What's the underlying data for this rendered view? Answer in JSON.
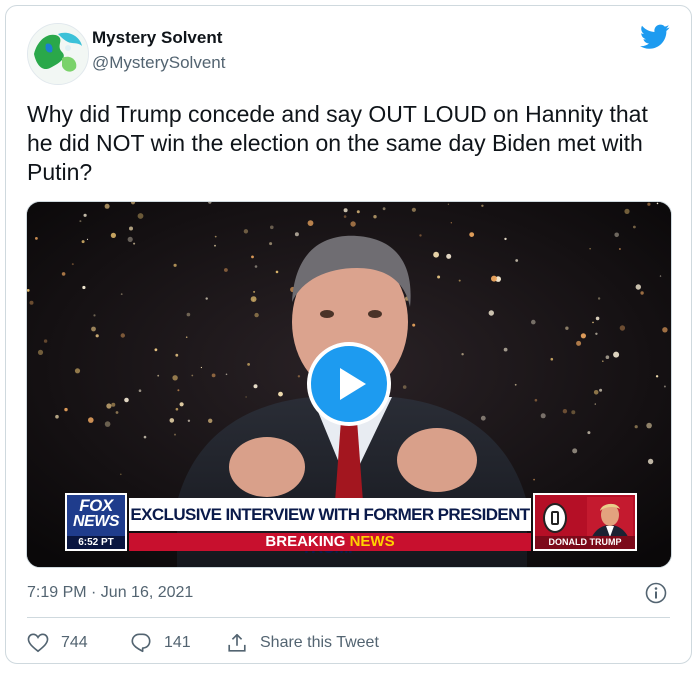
{
  "author": {
    "name": "Mystery Solvent",
    "handle": "@MysterySolvent"
  },
  "tweet": {
    "text": "Why did Trump concede and say OUT LOUD on Hannity that he did NOT win the election on the same day Biden met with Putin?",
    "timestamp": "7:19 PM · Jun 16, 2021"
  },
  "media": {
    "type": "video",
    "chyron": {
      "network_line1": "FOX",
      "network_line2": "NEWS",
      "clock": "6:52 PT",
      "headline": "EXCLUSIVE INTERVIEW WITH FORMER PRESIDENT TRUMP",
      "breaking_word": "BREAKING",
      "news_word": "NEWS",
      "guest_label": "DONALD TRUMP"
    }
  },
  "actions": {
    "likes": "744",
    "replies": "141",
    "share_label": "Share this Tweet"
  },
  "icons": {
    "brand": "twitter-bird-icon",
    "like": "heart-icon",
    "reply": "speech-bubble-icon",
    "share": "share-upload-icon",
    "info": "info-icon",
    "play": "play-icon"
  },
  "colors": {
    "brand_blue": "#1d9bf0",
    "text_primary": "#0f1419",
    "text_secondary": "#536471",
    "border": "#cfd9de",
    "chyron_red": "#c8102e",
    "chyron_navy": "#1f3c8c"
  }
}
